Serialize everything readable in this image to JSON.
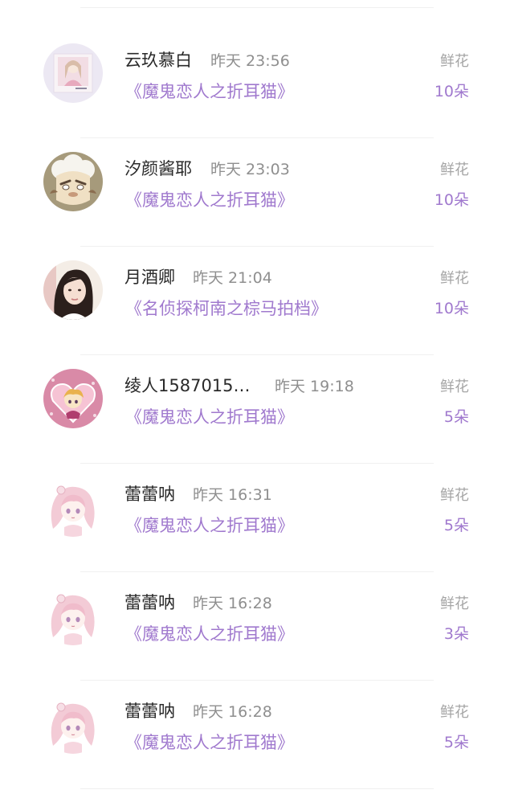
{
  "records": [
    {
      "name": "云玖慕白",
      "time": "昨天 23:56",
      "book": "《魔鬼恋人之折耳猫》",
      "gift": "鲜花",
      "count": "10朵",
      "avatar_icon": "anime-girl-photo-avatar-icon"
    },
    {
      "name": "汐颜酱耶",
      "time": "昨天 23:03",
      "book": "《魔鬼恋人之折耳猫》",
      "gift": "鲜花",
      "count": "10朵",
      "avatar_icon": "cartoon-sheep-avatar-icon"
    },
    {
      "name": "月酒卿",
      "time": "昨天 21:04",
      "book": "《名侦探柯南之棕马拍档》",
      "gift": "鲜花",
      "count": "10朵",
      "avatar_icon": "woman-portrait-avatar-icon"
    },
    {
      "name": "绫人1587015…",
      "time": "昨天 19:18",
      "book": "《魔鬼恋人之折耳猫》",
      "gift": "鲜花",
      "count": "5朵",
      "avatar_icon": "pink-heart-anime-avatar-icon"
    },
    {
      "name": "蕾蕾呐",
      "time": "昨天 16:31",
      "book": "《魔鬼恋人之折耳猫》",
      "gift": "鲜花",
      "count": "5朵",
      "avatar_icon": "pink-hair-anime-avatar-icon"
    },
    {
      "name": "蕾蕾呐",
      "time": "昨天 16:28",
      "book": "《魔鬼恋人之折耳猫》",
      "gift": "鲜花",
      "count": "3朵",
      "avatar_icon": "pink-hair-anime-avatar-icon"
    },
    {
      "name": "蕾蕾呐",
      "time": "昨天 16:28",
      "book": "《魔鬼恋人之折耳猫》",
      "gift": "鲜花",
      "count": "5朵",
      "avatar_icon": "pink-hair-anime-avatar-icon"
    }
  ],
  "colors": {
    "accent": "#a079ce",
    "name": "#2a2a2a",
    "muted": "#8f8f8f",
    "divider": "#f0f0f0"
  }
}
